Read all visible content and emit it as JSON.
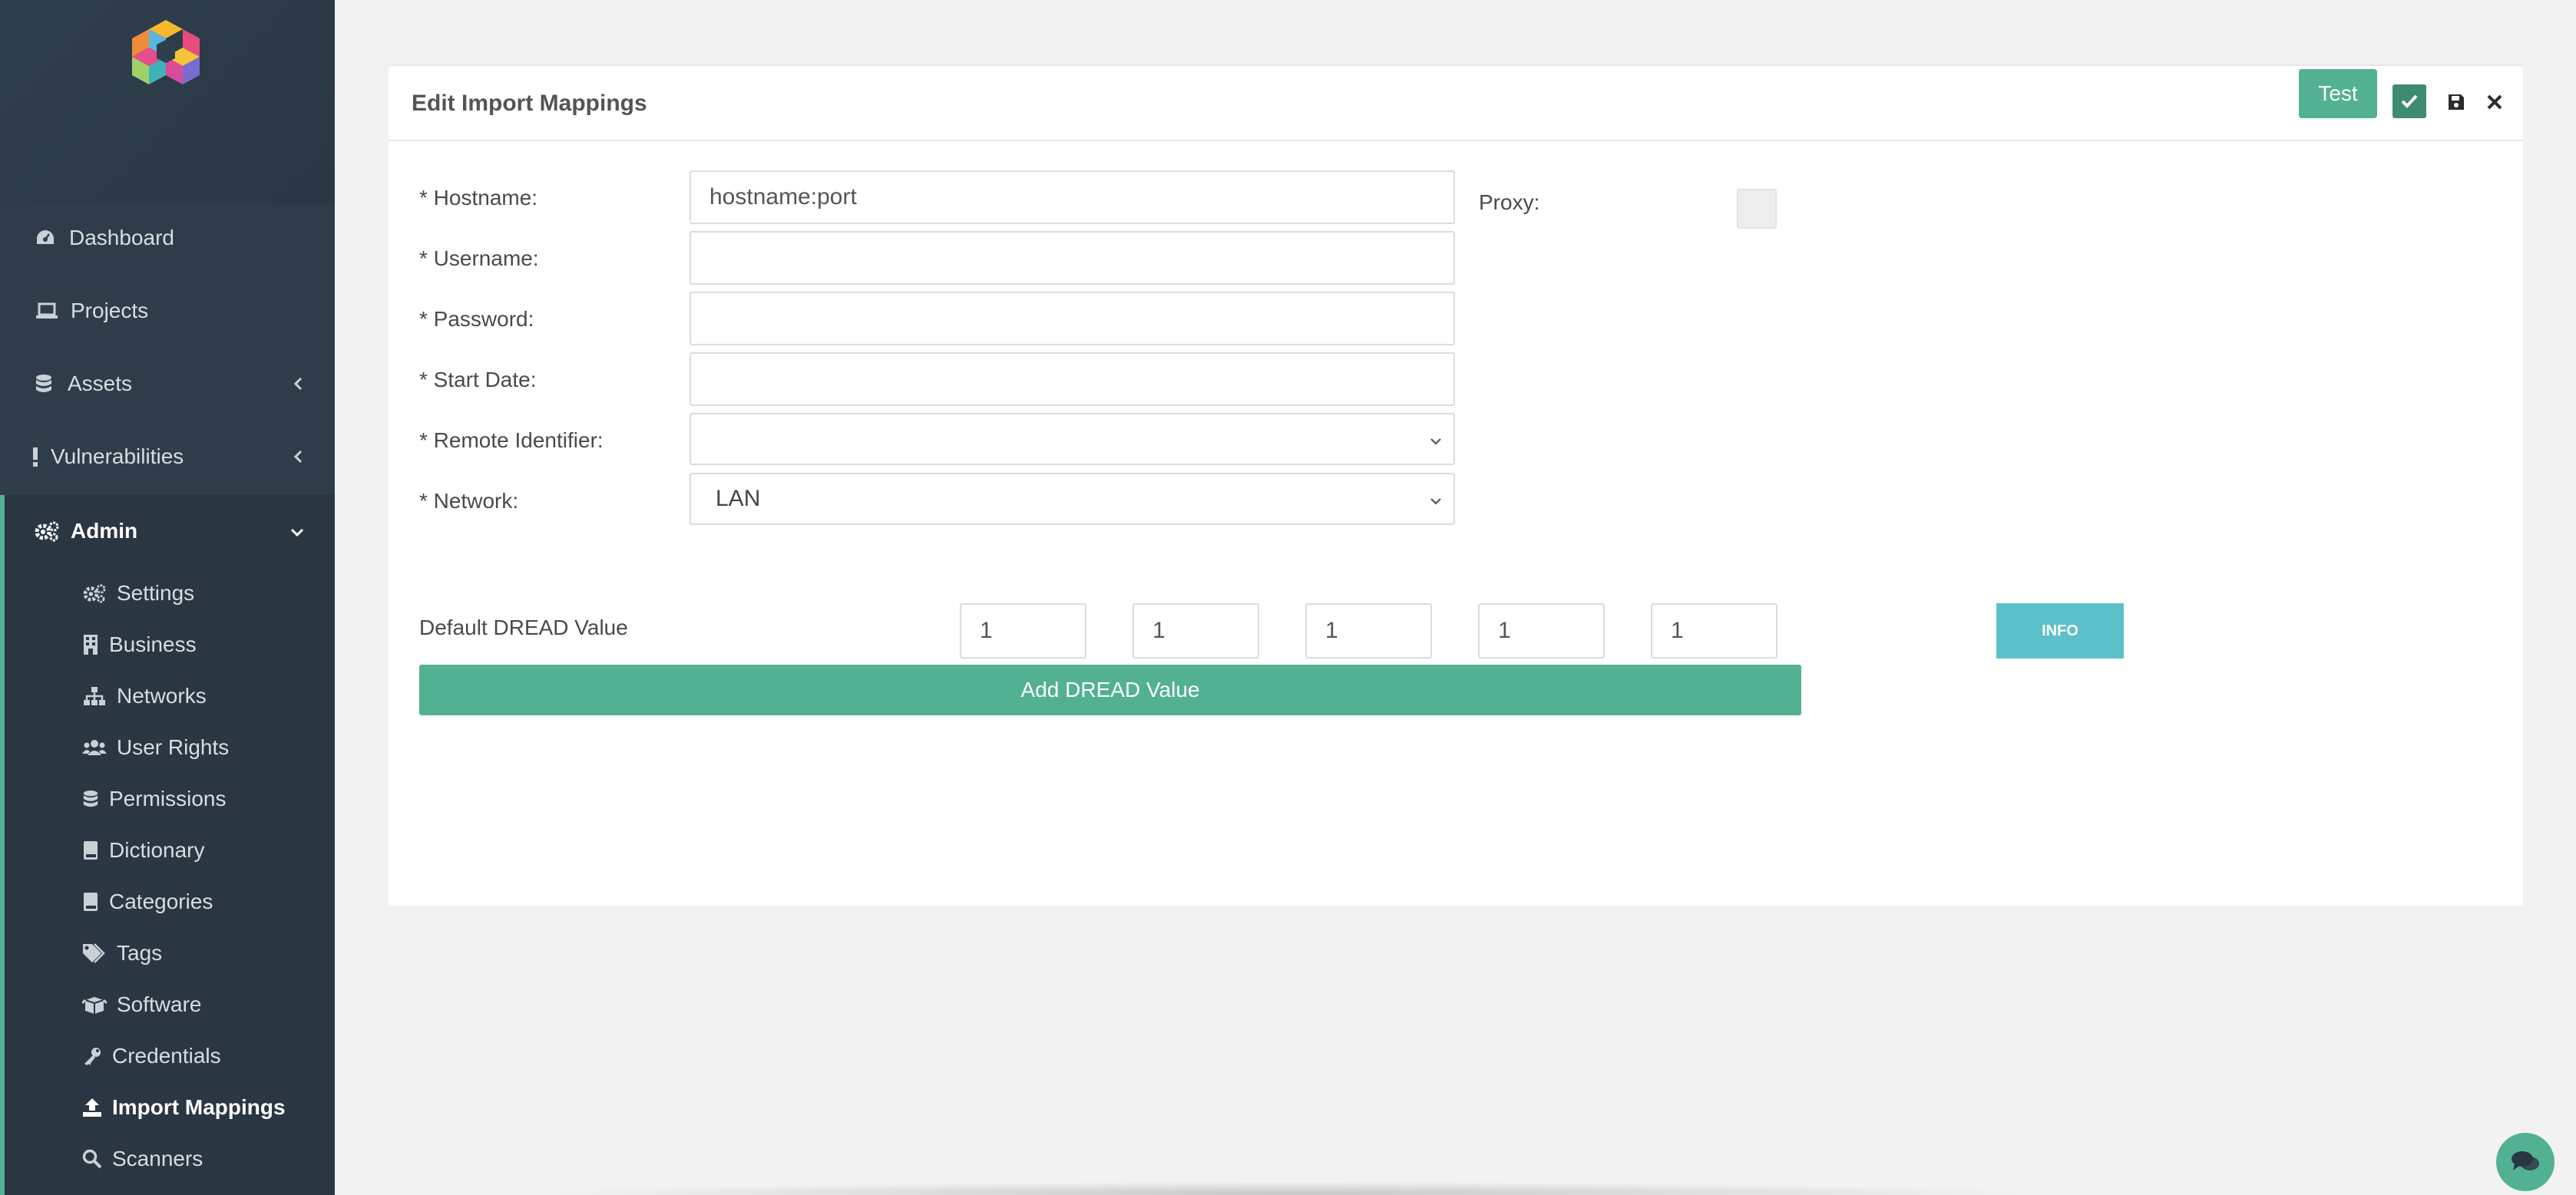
{
  "sidebar": {
    "logo": "app-logo",
    "items": [
      {
        "label": "Dashboard",
        "icon": "dashboard-icon"
      },
      {
        "label": "Projects",
        "icon": "laptop-icon"
      },
      {
        "label": "Assets",
        "icon": "database-icon"
      },
      {
        "label": "Vulnerabilities",
        "icon": "exclamation-icon"
      },
      {
        "label": "Admin",
        "icon": "cogs-icon"
      }
    ],
    "admin_items": [
      {
        "label": "Settings",
        "icon": "cogs-icon"
      },
      {
        "label": "Business",
        "icon": "building-icon"
      },
      {
        "label": "Networks",
        "icon": "sitemap-icon"
      },
      {
        "label": "User Rights",
        "icon": "users-icon"
      },
      {
        "label": "Permissions",
        "icon": "database-icon"
      },
      {
        "label": "Dictionary",
        "icon": "book-icon"
      },
      {
        "label": "Categories",
        "icon": "book-icon"
      },
      {
        "label": "Tags",
        "icon": "tags-icon"
      },
      {
        "label": "Software",
        "icon": "box-icon"
      },
      {
        "label": "Credentials",
        "icon": "key-icon"
      },
      {
        "label": "Import Mappings",
        "icon": "upload-icon"
      },
      {
        "label": "Scanners",
        "icon": "search-icon"
      }
    ],
    "active_item": "Import Mappings",
    "accent": "#52b193"
  },
  "panel": {
    "title": "Edit Import Mappings",
    "test_label": "Test",
    "fields": {
      "hostname": {
        "label": "* Hostname:",
        "value": "hostname:port"
      },
      "username": {
        "label": "* Username:",
        "value": ""
      },
      "password": {
        "label": "* Password:",
        "value": ""
      },
      "start_date": {
        "label": "* Start Date:",
        "value": ""
      },
      "remote_identifier": {
        "label": "* Remote Identifier:",
        "value": ""
      },
      "network": {
        "label": "* Network:",
        "value": "LAN"
      }
    },
    "proxy_label": "Proxy:",
    "dread": {
      "label": "Default DREAD Value",
      "values": [
        "1",
        "1",
        "1",
        "1",
        "1"
      ],
      "info_label": "INFO",
      "add_label": "Add DREAD Value"
    }
  },
  "colors": {
    "sidebar_bg": "#2f3d4a",
    "primary": "#52b193",
    "info": "#5bc0c8",
    "page_bg": "#f2f2f2"
  }
}
